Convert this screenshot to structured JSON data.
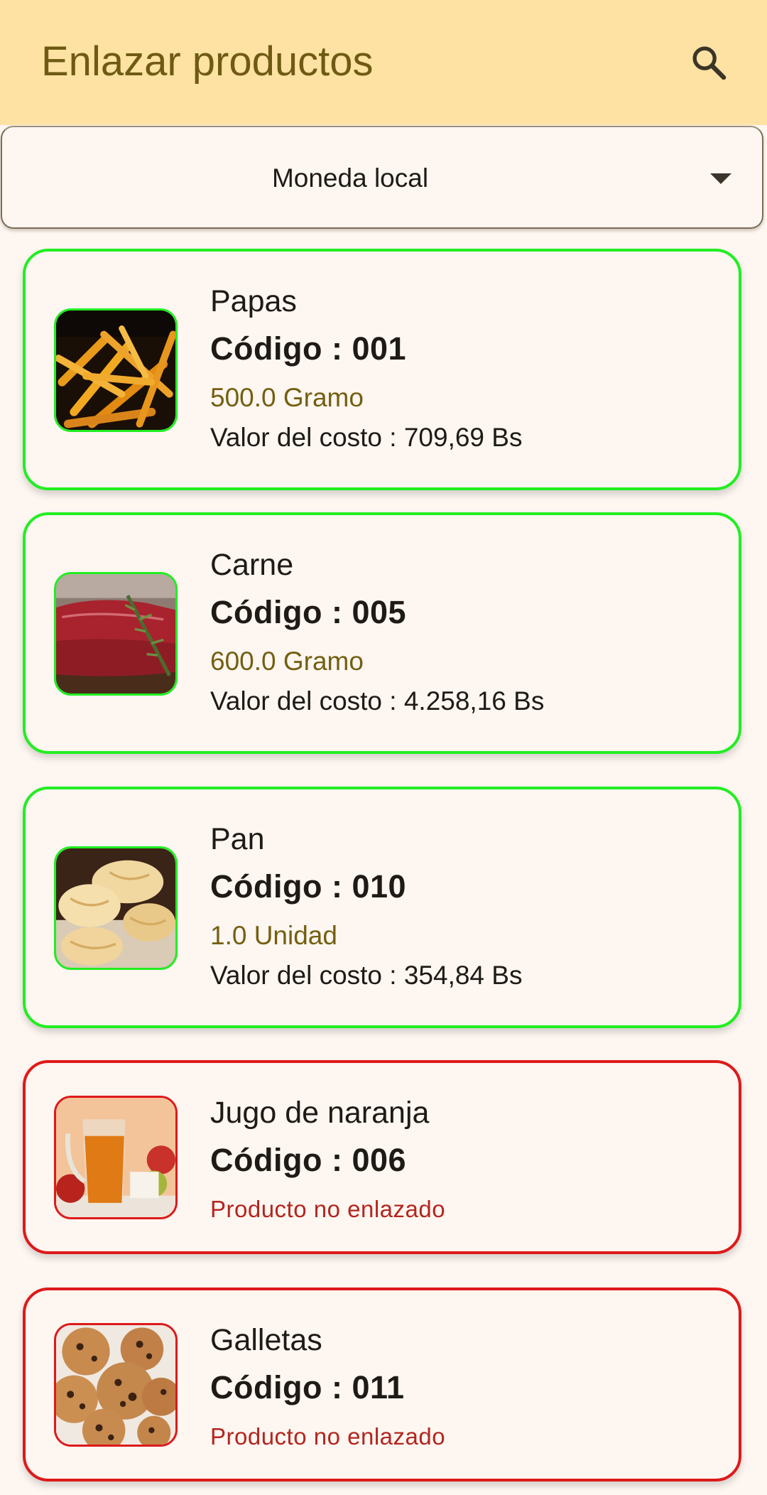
{
  "appbar": {
    "title": "Enlazar productos",
    "search_icon": "search-icon"
  },
  "currency_select": {
    "selected": "Moneda local",
    "icon": "arrow-drop-down-icon"
  },
  "colors": {
    "appbar_bg": "#fee2a3",
    "title": "#6f5a13",
    "linked_border": "#22ee22",
    "unlinked_border": "#dd1a1a",
    "quantity_text": "#745f10",
    "unlinked_text": "#b3261e"
  },
  "products": [
    {
      "name": "Papas",
      "code": "Código : 001",
      "linked": true,
      "quantity": "500.0 Gramo",
      "cost": "Valor del costo : 709,69 Bs",
      "image": "fries-photo"
    },
    {
      "name": "Carne",
      "code": "Código : 005",
      "linked": true,
      "quantity": "600.0 Gramo",
      "cost": "Valor del costo : 4.258,16 Bs",
      "image": "meat-photo"
    },
    {
      "name": "Pan",
      "code": "Código : 010",
      "linked": true,
      "quantity": "1.0 Unidad",
      "cost": "Valor del costo : 354,84 Bs",
      "image": "bread-photo"
    },
    {
      "name": "Jugo de naranja",
      "code": "Código : 006",
      "linked": false,
      "status": "Producto no enlazado",
      "image": "orange-juice-photo"
    },
    {
      "name": "Galletas",
      "code": "Código : 011",
      "linked": false,
      "status": "Producto no enlazado",
      "image": "cookies-photo"
    }
  ]
}
